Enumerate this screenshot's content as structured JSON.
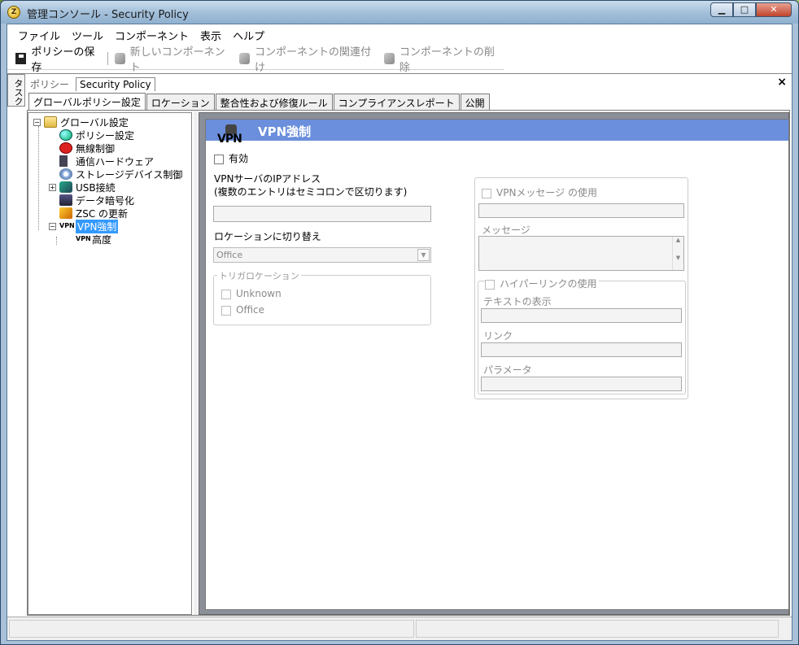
{
  "window": {
    "title": "管理コンソール - Security Policy",
    "icon_letter": "Z"
  },
  "window_controls": {
    "minimize": "▁",
    "maximize": "□",
    "close": "✕"
  },
  "menu": [
    "ファイル",
    "ツール",
    "コンポーネント",
    "表示",
    "ヘルプ"
  ],
  "toolbar": {
    "save": "ポリシーの保存",
    "new_component": "新しいコンポーネント",
    "associate": "コンポーネントの関連付け",
    "delete": "コンポーネントの削除"
  },
  "side_task": "タスク",
  "doc_tab": {
    "prefix": "ポリシー",
    "name": "Security Policy",
    "close": "×"
  },
  "tabs": [
    "グローバルポリシー設定",
    "ロケーション",
    "整合性および修復ルール",
    "コンプライアンスレポート",
    "公開"
  ],
  "tree": {
    "root": "グローバル設定",
    "items": [
      "ポリシー設定",
      "無線制御",
      "通信ハードウェア",
      "ストレージデバイス制御",
      "USB接続",
      "データ暗号化",
      "ZSC の更新",
      "VPN強制"
    ],
    "child": "高度",
    "expander_minus": "−",
    "expander_plus": "+"
  },
  "panel": {
    "title": "VPN強制",
    "logo_text": "VPN",
    "enabled": "有効",
    "ip_label_1": "VPNサーバのIPアドレス",
    "ip_label_2": "(複数のエントリはセミコロンで区切ります)",
    "switch_label": "ロケーションに切り替え",
    "switch_value": "Office",
    "trigger_group": "トリガロケーション",
    "trigger_options": [
      "Unknown",
      "Office"
    ],
    "vpn_message_use": "VPNメッセージ の使用",
    "message_label": "メッセージ",
    "hyperlink_use": "ハイパーリンクの使用",
    "display_text": "テキストの表示",
    "link": "リンク",
    "parameters": "パラメータ",
    "arrow_up": "▲",
    "arrow_down": "▼"
  }
}
